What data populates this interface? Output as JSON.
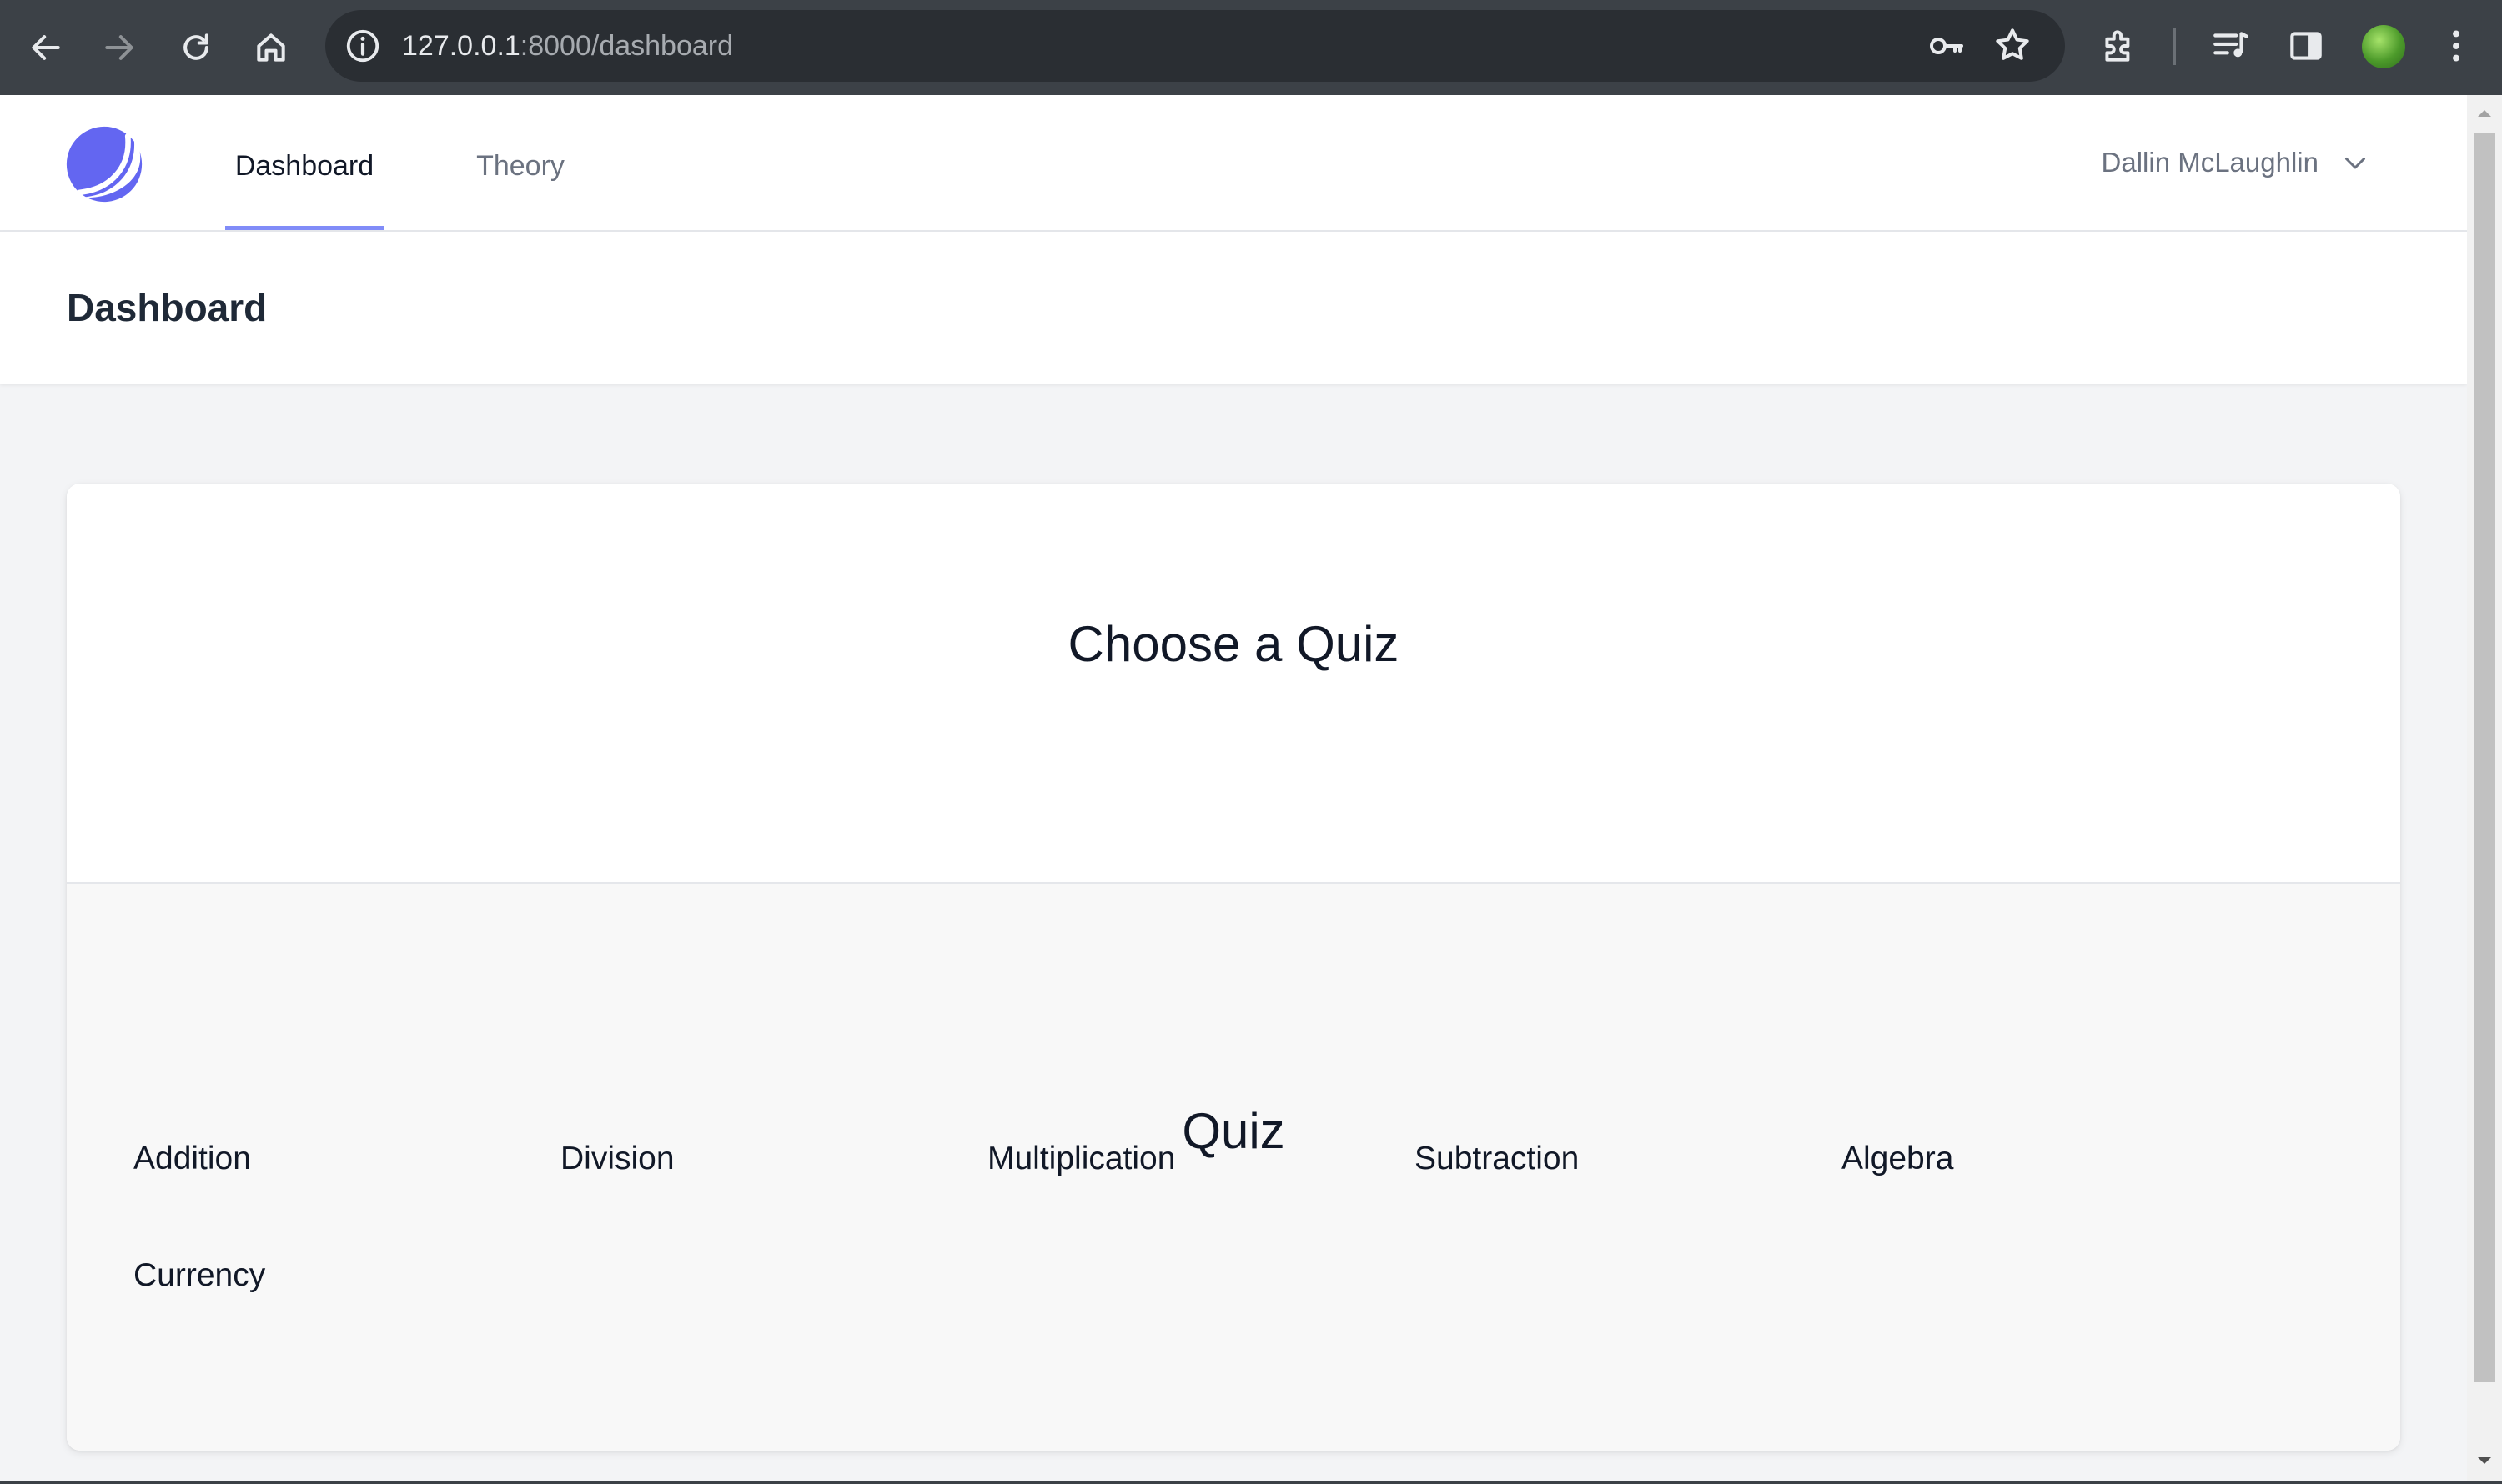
{
  "browser": {
    "url_host": "127.0.0.1",
    "url_path": ":8000/dashboard",
    "icons": [
      "back-arrow-icon",
      "forward-arrow-icon",
      "reload-icon",
      "home-icon",
      "site-info-icon",
      "password-key-icon",
      "bookmark-star-icon",
      "extensions-icon",
      "media-control-icon",
      "side-panel-icon",
      "profile-avatar-icon",
      "more-menu-icon"
    ]
  },
  "header": {
    "tabs": [
      {
        "label": "Dashboard",
        "active": true
      },
      {
        "label": "Theory",
        "active": false
      }
    ],
    "user_name": "Dallin McLaughlin",
    "accent_color": "#818cf8"
  },
  "page": {
    "title": "Dashboard"
  },
  "card": {
    "title": "Choose a Quiz",
    "section_title": "Quiz",
    "quizzes": [
      "Addition",
      "Division",
      "Multiplication",
      "Subtraction",
      "Algebra",
      "Currency"
    ]
  }
}
